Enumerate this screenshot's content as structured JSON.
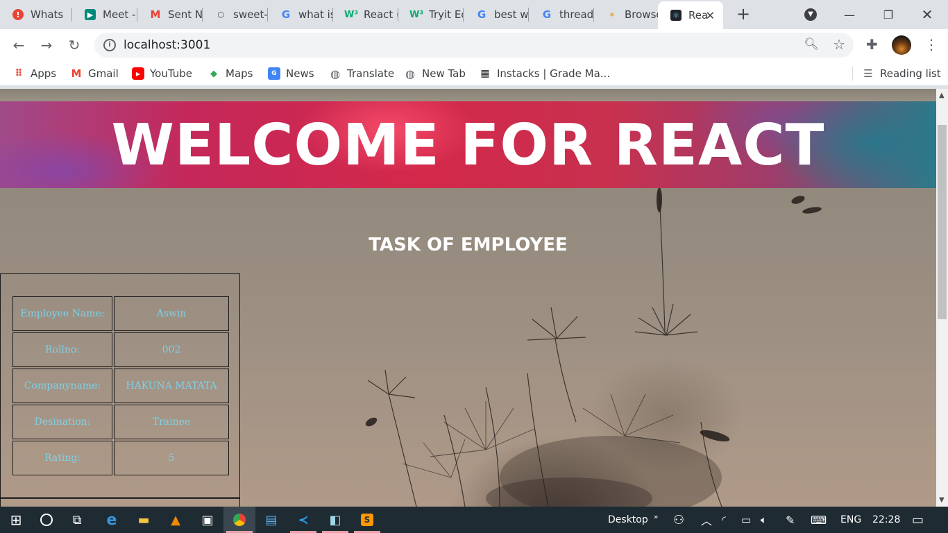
{
  "browser": {
    "tabs": [
      {
        "title": "Whats",
        "icon": "alert-icon"
      },
      {
        "title": "Meet -",
        "icon": "meet-icon"
      },
      {
        "title": "Sent N",
        "icon": "gmail-icon"
      },
      {
        "title": "sweet-",
        "icon": "package-icon"
      },
      {
        "title": "what is",
        "icon": "google-icon"
      },
      {
        "title": "React (",
        "icon": "w3schools-icon"
      },
      {
        "title": "Tryit Ec",
        "icon": "w3schools-icon"
      },
      {
        "title": "best w",
        "icon": "google-icon"
      },
      {
        "title": "thread",
        "icon": "google-icon"
      },
      {
        "title": "Browse",
        "icon": "browserstack-icon"
      },
      {
        "title": "Rea",
        "icon": "react-icon",
        "active": true
      }
    ],
    "address": "localhost:3001",
    "bookmarks": [
      {
        "label": "Apps",
        "icon": "apps-grid-icon"
      },
      {
        "label": "Gmail",
        "icon": "gmail-icon"
      },
      {
        "label": "YouTube",
        "icon": "youtube-icon"
      },
      {
        "label": "Maps",
        "icon": "maps-icon"
      },
      {
        "label": "News",
        "icon": "news-icon"
      },
      {
        "label": "Translate",
        "icon": "globe-icon"
      },
      {
        "label": "New Tab",
        "icon": "globe-icon"
      },
      {
        "label": "Instacks | Grade Ma...",
        "icon": "instacks-icon"
      }
    ],
    "reading_list": "Reading list"
  },
  "page": {
    "banner_title": "WELCOME FOR REACT",
    "subtitle": "TASK OF EMPLOYEE",
    "employee_table": [
      {
        "label": "Employee Name:",
        "value": "Aswin"
      },
      {
        "label": "Rollno:",
        "value": "002"
      },
      {
        "label": "Companyname:",
        "value": "HAKUNA MATATA"
      },
      {
        "label": "Desination:",
        "value": "Trainee"
      },
      {
        "label": "Rating:",
        "value": "5"
      }
    ],
    "table_text_color": "#7fd0e8"
  },
  "taskbar": {
    "apps": [
      "windows-start-icon",
      "cortana-icon",
      "task-view-icon",
      "edge-icon",
      "file-explorer-icon",
      "vlc-icon",
      "store-icon",
      "chrome-icon",
      "notepad-icon",
      "vscode-icon",
      "notes-icon",
      "sublime-icon"
    ],
    "desktop_label": "Desktop",
    "language": "ENG",
    "time": "22:28"
  }
}
